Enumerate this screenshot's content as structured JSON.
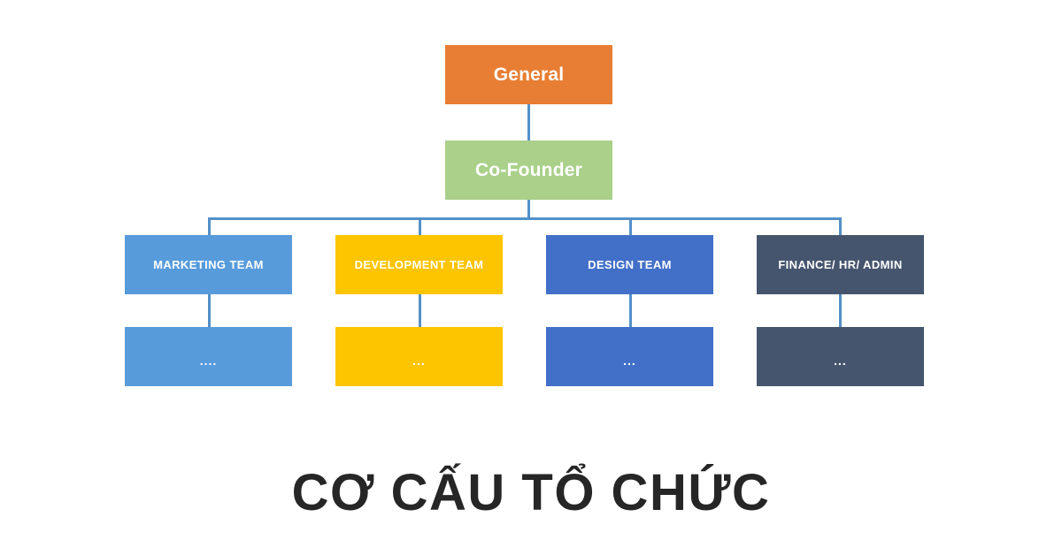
{
  "title": "CƠ CẤU TỔ CHỨC",
  "colors": {
    "background": "#ffffff",
    "connector": "#5390c8",
    "title_text": "#262626",
    "node_text": "#ffffff",
    "general": "#e87e33",
    "cofounder": "#aad08a",
    "marketing": "#579bdb",
    "development": "#fdc400",
    "design": "#4270c8",
    "finance": "#46556e"
  },
  "hierarchy": {
    "root": {
      "label": "General",
      "color": "#e87e33"
    },
    "second": {
      "label": "Co-Founder",
      "color": "#aad08a"
    },
    "teams": [
      {
        "label": "MARKETING TEAM",
        "color": "#579bdb",
        "sub_label": "....",
        "sub_color": "#579bdb"
      },
      {
        "label": "DEVELOPMENT TEAM",
        "color": "#fdc400",
        "sub_label": "...",
        "sub_color": "#fdc400"
      },
      {
        "label": "DESIGN TEAM",
        "color": "#4270c8",
        "sub_label": "...",
        "sub_color": "#4270c8"
      },
      {
        "label": "FINANCE/ HR/ ADMIN",
        "color": "#46556e",
        "sub_label": "...",
        "sub_color": "#46556e"
      }
    ]
  }
}
